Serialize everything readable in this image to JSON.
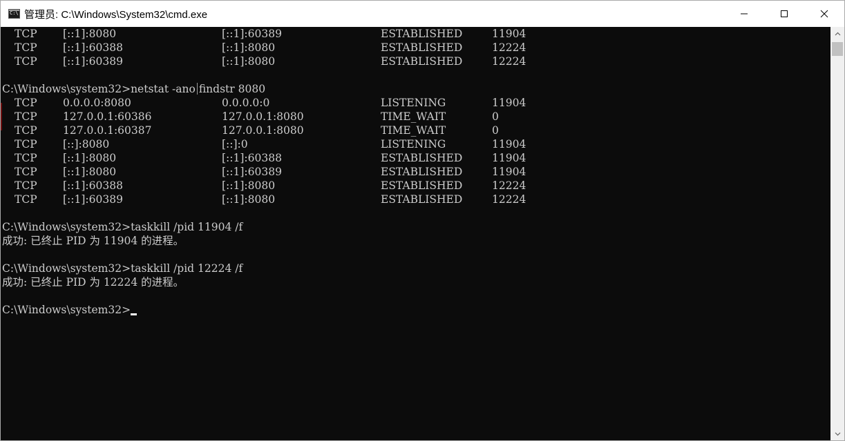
{
  "window": {
    "title": "管理员: C:\\Windows\\System32\\cmd.exe",
    "icon": "cmd-console-icon",
    "controls": [
      "minimize-icon",
      "maximize-icon",
      "close-icon"
    ]
  },
  "console": {
    "top_rows": [
      [
        "TCP",
        "[::1]:8080",
        "[::1]:60389",
        "ESTABLISHED",
        "11904"
      ],
      [
        "TCP",
        "[::1]:60388",
        "[::1]:8080",
        "ESTABLISHED",
        "12224"
      ],
      [
        "TCP",
        "[::1]:60389",
        "[::1]:8080",
        "ESTABLISHED",
        "12224"
      ]
    ],
    "netstat": {
      "prompt": "C:\\Windows\\system32>",
      "cmd_part1": "netstat -ano",
      "cmd_part2": "findstr 8080",
      "rows": [
        [
          "TCP",
          "0.0.0.0:8080",
          "0.0.0.0:0",
          "LISTENING",
          "11904"
        ],
        [
          "TCP",
          "127.0.0.1:60386",
          "127.0.0.1:8080",
          "TIME_WAIT",
          "0"
        ],
        [
          "TCP",
          "127.0.0.1:60387",
          "127.0.0.1:8080",
          "TIME_WAIT",
          "0"
        ],
        [
          "TCP",
          "[::]:8080",
          "[::]:0",
          "LISTENING",
          "11904"
        ],
        [
          "TCP",
          "[::1]:8080",
          "[::1]:60388",
          "ESTABLISHED",
          "11904"
        ],
        [
          "TCP",
          "[::1]:8080",
          "[::1]:60389",
          "ESTABLISHED",
          "11904"
        ],
        [
          "TCP",
          "[::1]:60388",
          "[::1]:8080",
          "ESTABLISHED",
          "12224"
        ],
        [
          "TCP",
          "[::1]:60389",
          "[::1]:8080",
          "ESTABLISHED",
          "12224"
        ]
      ]
    },
    "kill1": {
      "prompt": "C:\\Windows\\system32>",
      "cmd": "taskkill /pid 11904 /f",
      "result": "成功: 已终止 PID 为 11904 的进程。"
    },
    "kill2": {
      "prompt": "C:\\Windows\\system32>",
      "cmd": "taskkill /pid 12224 /f",
      "result": "成功: 已终止 PID 为 12224 的进程。"
    },
    "final_prompt": "C:\\Windows\\system32>"
  },
  "colors": {
    "console_bg": "#0c0c0c",
    "console_text": "#cccccc",
    "titlebar_bg": "#ffffff",
    "scrollbar_bg": "#f0f0f0",
    "scrollbar_thumb": "#c1c1c1"
  }
}
